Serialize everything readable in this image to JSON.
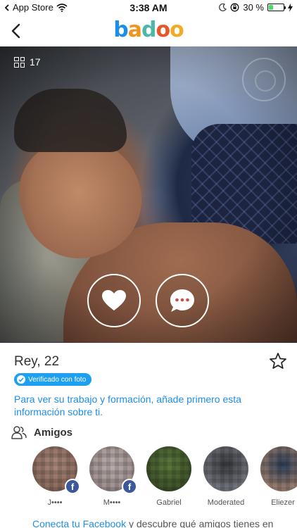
{
  "status_bar": {
    "carrier": "App Store",
    "time": "3:38 AM",
    "battery_percent": "30 %",
    "battery_level": 0.3
  },
  "nav": {
    "logo_letters": [
      "b",
      "a",
      "d",
      "o",
      "o"
    ],
    "logo_colors": [
      "#1e8ee6",
      "#f1941d",
      "#4cb8a8",
      "#e8562a",
      "#f0ac24"
    ]
  },
  "photo": {
    "count": "17"
  },
  "profile": {
    "name_age": "Rey, 22",
    "verified_label": "Verificado con foto",
    "work_prompt": "Para ver su trabajo y formación, añade primero esta información sobre ti."
  },
  "friends": {
    "title": "Amigos",
    "items": [
      {
        "name": "J••••",
        "facebook": true,
        "colors": [
          "#a9887a",
          "#7a5c4e"
        ]
      },
      {
        "name": "M••••",
        "facebook": true,
        "colors": [
          "#bcb0ae",
          "#8e7f7e"
        ]
      },
      {
        "name": "Gabriel",
        "facebook": false,
        "colors": [
          "#5d7a3c",
          "#2f3e22"
        ]
      },
      {
        "name": "Moderated",
        "facebook": false,
        "colors": [
          "#3a3a3e",
          "#8a8f99"
        ]
      },
      {
        "name": "Eliezer",
        "facebook": false,
        "colors": [
          "#2c3e5a",
          "#c99978"
        ]
      }
    ],
    "connect_link": "Conecta tu Facebook",
    "connect_rest": " y descubre qué amigos tienes en"
  },
  "icons": {
    "wifi": "wifi-icon",
    "moon": "moon-icon",
    "lock_rotation": "rotation-lock-icon",
    "charging": "charging-bolt-icon",
    "back": "chevron-left-icon",
    "photos": "grid-icon",
    "like": "heart-icon",
    "chat": "chat-bubble-icon",
    "favorite": "star-icon",
    "friends": "friends-icon"
  }
}
